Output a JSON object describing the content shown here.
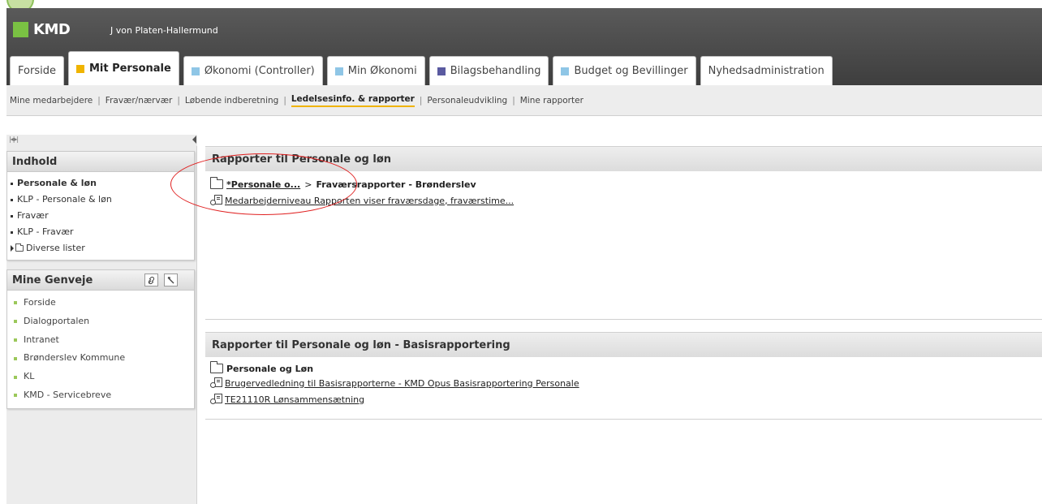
{
  "brand": {
    "logo_text": "KMD",
    "logo_color": "#7ac143"
  },
  "header": {
    "user_name": "J von Platen-Hallermund"
  },
  "tabs": [
    {
      "label": "Forside",
      "color": null,
      "active": false
    },
    {
      "label": "Mit Personale",
      "color": "#f0b400",
      "active": true
    },
    {
      "label": "Økonomi (Controller)",
      "color": "#8fc6e6",
      "active": false
    },
    {
      "label": "Min Økonomi",
      "color": "#8fc6e6",
      "active": false
    },
    {
      "label": "Bilagsbehandling",
      "color": "#5a5aa0",
      "active": false
    },
    {
      "label": "Budget og Bevillinger",
      "color": "#8fc6e6",
      "active": false
    },
    {
      "label": "Nyhedsadministration",
      "color": null,
      "active": false
    }
  ],
  "subnav": {
    "items": [
      "Mine medarbejdere",
      "Fravær/nærvær",
      "Løbende indberetning",
      "Ledelsesinfo. & rapporter",
      "Personaleudvikling",
      "Mine rapporter"
    ],
    "active_index": 3,
    "separator": "|"
  },
  "sidebar": {
    "collapse_controls": "|◂|▸|",
    "indhold": {
      "title": "Indhold",
      "items": [
        "Personale & løn",
        "KLP - Personale & løn",
        "Fravær",
        "KLP - Fravær"
      ],
      "folder_item": "Diverse lister"
    },
    "genveje": {
      "title": "Mine Genveje",
      "items": [
        "Forside",
        "Dialogportalen",
        "Intranet",
        "Brønderslev Kommune",
        "KL",
        "KMD - Servicebreve"
      ]
    }
  },
  "main": {
    "panel1": {
      "title": "Rapporter til Personale og løn",
      "breadcrumb_link": "*Personale o...",
      "breadcrumb_sep": ">",
      "breadcrumb_current": "Fraværsrapporter - Brønderslev",
      "reports": [
        "Medarbejderniveau  Rapporten viser fraværsdage, fraværstime..."
      ]
    },
    "panel2": {
      "title": "Rapporter til Personale og løn - Basisrapportering",
      "folder": "Personale og Løn",
      "reports": [
        "Brugervedledning til Basisrapporterne - KMD Opus Basisrapportering Personale",
        "TE21110R Lønsammensætning"
      ]
    }
  }
}
